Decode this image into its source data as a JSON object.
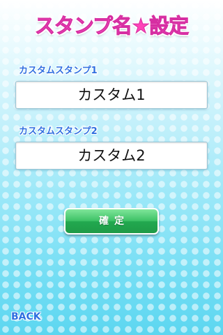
{
  "screen": {
    "title": "スタンプ名★設定",
    "title_text_before": "スタンプ名",
    "title_star": "★",
    "title_text_after": "設定"
  },
  "fields": [
    {
      "label": "カスタムスタンプ1",
      "value": "カスタム1"
    },
    {
      "label": "カスタムスタンプ2",
      "value": "カスタム2"
    }
  ],
  "buttons": {
    "confirm_label": "確定",
    "back_label": "BACK"
  },
  "colors": {
    "title_pink": "#ff5bc7",
    "label_blue": "#2f6fe0",
    "button_green": "#3ec266",
    "background_cyan": "#6fdff4"
  }
}
